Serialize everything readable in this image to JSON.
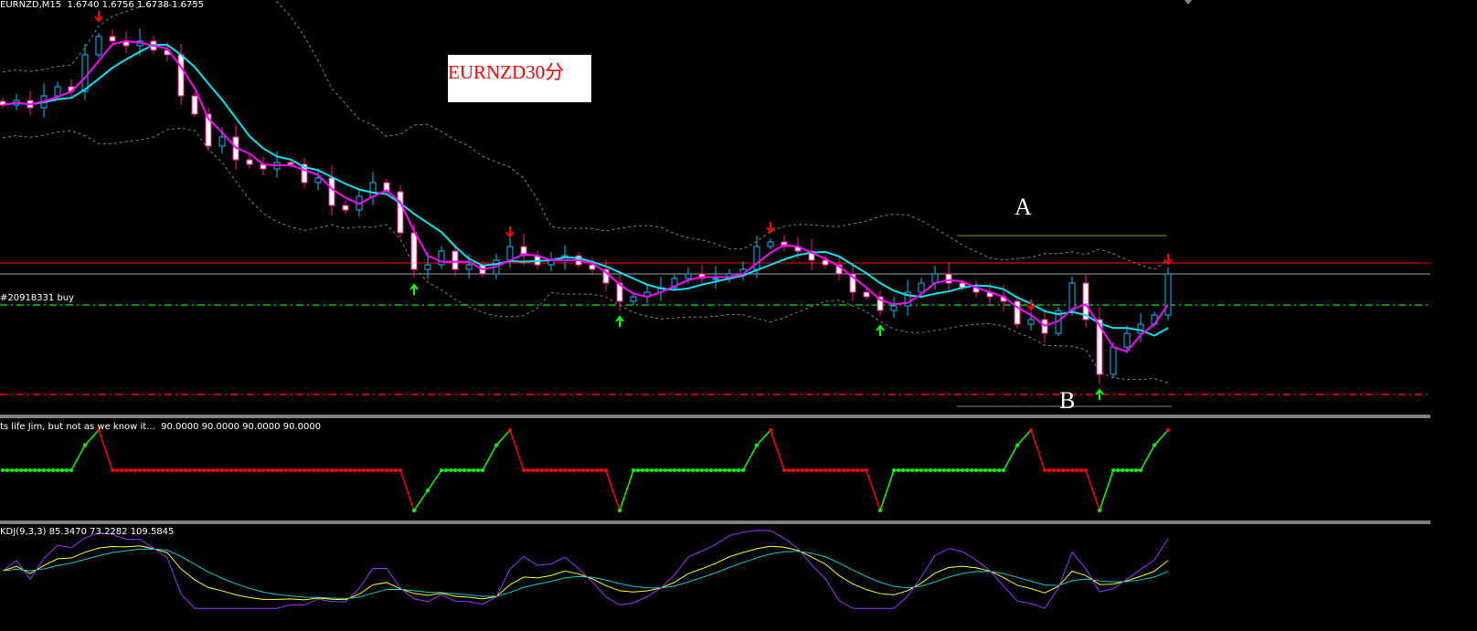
{
  "header": {
    "symbol": "EURNZD,M15",
    "ohlc": "1.6740 1.6756 1.6738 1.6755"
  },
  "annotation_box": "EURNZD30分",
  "order_label": "#20918331 buy",
  "indicator1_label": "ts life Jim, but not as we know it...  90.0000 90.0000 90.0000 90.0000",
  "indicator2_label": "KDJ(9,3,3) 85.3470 73.2282 109.5845",
  "marker_a": "A",
  "marker_b": "B",
  "colors": {
    "bull": "#00bfff",
    "bear_fill": "#ffffff",
    "bear_edge": "#ff1493",
    "ma_fast": "#ff00ff",
    "ma_slow": "#00e5ee",
    "bands": "#808080",
    "up_arrow": "#00ff00",
    "down_arrow": "#ff0000",
    "k": "#ffff00",
    "d": "#00ced1",
    "j": "#9b30ff"
  },
  "chart_data": {
    "type": "candlestick",
    "ylim": [
      1.66775,
      1.6905
    ],
    "grid": false,
    "closes": [
      1.68475,
      1.685,
      1.6846,
      1.68525,
      1.68575,
      1.6855,
      1.6875,
      1.6885,
      1.68825,
      1.688,
      1.68825,
      1.68775,
      1.6875,
      1.68525,
      1.68425,
      1.6825,
      1.683,
      1.68175,
      1.6815,
      1.68125,
      1.6816,
      1.6815,
      1.6805,
      1.68075,
      1.67925,
      1.679,
      1.67975,
      1.6805,
      1.68,
      1.67775,
      1.67575,
      1.676,
      1.67675,
      1.67575,
      1.676,
      1.6755,
      1.67625,
      1.677,
      1.6765,
      1.676,
      1.67625,
      1.6765,
      1.676,
      1.67575,
      1.675,
      1.674,
      1.67425,
      1.6745,
      1.67475,
      1.67525,
      1.6755,
      1.67525,
      1.67525,
      1.6755,
      1.67575,
      1.677,
      1.67725,
      1.677,
      1.67675,
      1.67625,
      1.676,
      1.6755,
      1.6745,
      1.67425,
      1.6735,
      1.67375,
      1.6745,
      1.675,
      1.6755,
      1.675,
      1.67475,
      1.6745,
      1.67425,
      1.674,
      1.67275,
      1.673,
      1.67225,
      1.6735,
      1.675,
      1.673,
      1.67,
      1.6715,
      1.67225,
      1.67275,
      1.67325,
      1.6755
    ],
    "horizontal_lines": [
      {
        "price": 1.6761,
        "color": "#ff0000",
        "style": "solid"
      },
      {
        "price": 1.6755,
        "color": "#a0a0a0",
        "style": "solid"
      },
      {
        "price": 1.6738,
        "color": "#00c000",
        "style": "dash-dot",
        "label": "#20918331 buy"
      },
      {
        "price": 1.6689,
        "color": "#ff0000",
        "style": "dash-dot"
      }
    ],
    "level_a": 1.6776,
    "level_b": 1.66825,
    "down_arrows": [
      7,
      37,
      56,
      75,
      85
    ],
    "up_arrows": [
      30,
      45,
      64,
      80
    ],
    "indicator1": {
      "ylim": [
        0,
        100
      ],
      "values": [
        50,
        50,
        50,
        50,
        50,
        50,
        75,
        90,
        50,
        50,
        50,
        50,
        50,
        50,
        50,
        50,
        50,
        50,
        50,
        50,
        50,
        50,
        50,
        50,
        50,
        50,
        50,
        50,
        50,
        50,
        10,
        30,
        50,
        50,
        50,
        50,
        75,
        90,
        50,
        50,
        50,
        50,
        50,
        50,
        50,
        10,
        50,
        50,
        50,
        50,
        50,
        50,
        50,
        50,
        50,
        75,
        90,
        50,
        50,
        50,
        50,
        50,
        50,
        50,
        10,
        50,
        50,
        50,
        50,
        50,
        50,
        50,
        50,
        50,
        75,
        90,
        50,
        50,
        50,
        50,
        10,
        50,
        50,
        50,
        75,
        90
      ]
    },
    "indicator2": {
      "type": "line",
      "series": [
        "K",
        "D",
        "J"
      ],
      "params": "9,3,3"
    }
  }
}
